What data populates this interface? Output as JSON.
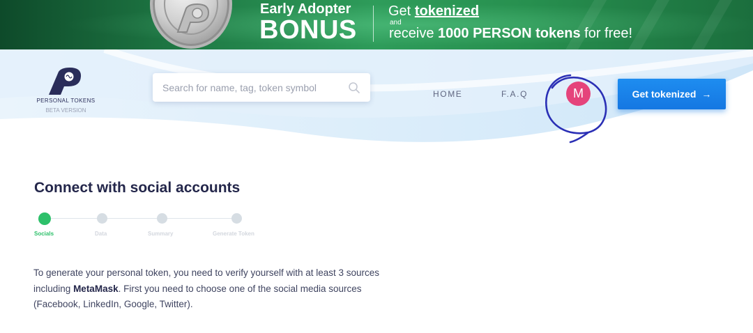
{
  "banner": {
    "title_small": "Early Adopter",
    "title_big": "BONUS",
    "get_prefix": "Get",
    "get_link": "tokenized",
    "and": "and",
    "receive_prefix": "receive",
    "receive_bold": "1000 PERSON tokens",
    "receive_suffix": "for free!"
  },
  "brand": {
    "name": "PERSONAL TOKENS",
    "subtitle": "BETA VERSION",
    "logo_color": "#2a2d5a"
  },
  "search": {
    "placeholder": "Search for name, tag, token symbol",
    "icon": "search-icon"
  },
  "nav": {
    "home": "HOME",
    "faq": "F.A.Q",
    "avatar_initial": "M",
    "cta_label": "Get tokenized",
    "cta_icon": "arrow-right-icon"
  },
  "main": {
    "title": "Connect with social accounts",
    "steps": [
      "Socials",
      "Data",
      "Summary",
      "Generate Token"
    ],
    "active_step": "Socials",
    "intro_part1": "To generate your personal token, you need to verify yourself with at least 3 sources",
    "intro_part2_prefix": "including",
    "intro_part2_bold": "MetaMask",
    "intro_part2_suffix": ". First you need to choose one of the social media sources",
    "intro_part3": "(Facebook, LinkedIn, Google, Twitter)."
  },
  "colors": {
    "banner_green": "#1f7a45",
    "primary_blue": "#1577e2",
    "avatar_pink": "#e5437b",
    "active_green": "#2dc06a",
    "annotation_ink": "#2a2fb5"
  }
}
